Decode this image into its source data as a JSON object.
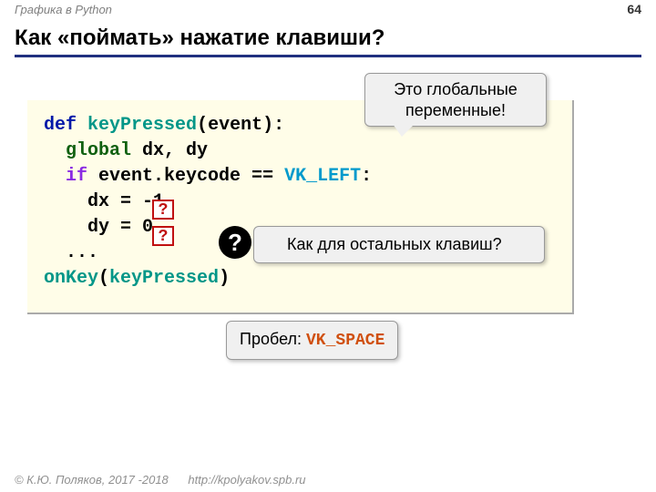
{
  "header": {
    "series": "Графика в Python",
    "page_number": "64"
  },
  "title": "Как «поймать» нажатие клавиши?",
  "code": {
    "def": "def",
    "fn": "keyPressed",
    "param": "(event):",
    "global_kw": "global",
    "global_vars": " dx, dy",
    "if_kw": "if",
    "if_cond_a": " event.keycode == ",
    "if_const": "VK_LEFT",
    "if_cond_b": ":",
    "assign_dx": "    dx = -1",
    "assign_dy": "    dy = 0",
    "dots": "  ...",
    "onkey_fn": "onKey",
    "onkey_open": "(",
    "onkey_arg": "keyPressed",
    "onkey_close": ")"
  },
  "mask": {
    "q": "?"
  },
  "callouts": {
    "global_vars": "Это глобальные переменные!",
    "rest_keys": "Как для остальных клавиш?",
    "space_label": "Пробел: ",
    "space_const": "VK_SPACE"
  },
  "qicon": "?",
  "footer": {
    "copyright": "© К.Ю. Поляков, 2017 -2018",
    "url": "http://kpolyakov.spb.ru"
  }
}
